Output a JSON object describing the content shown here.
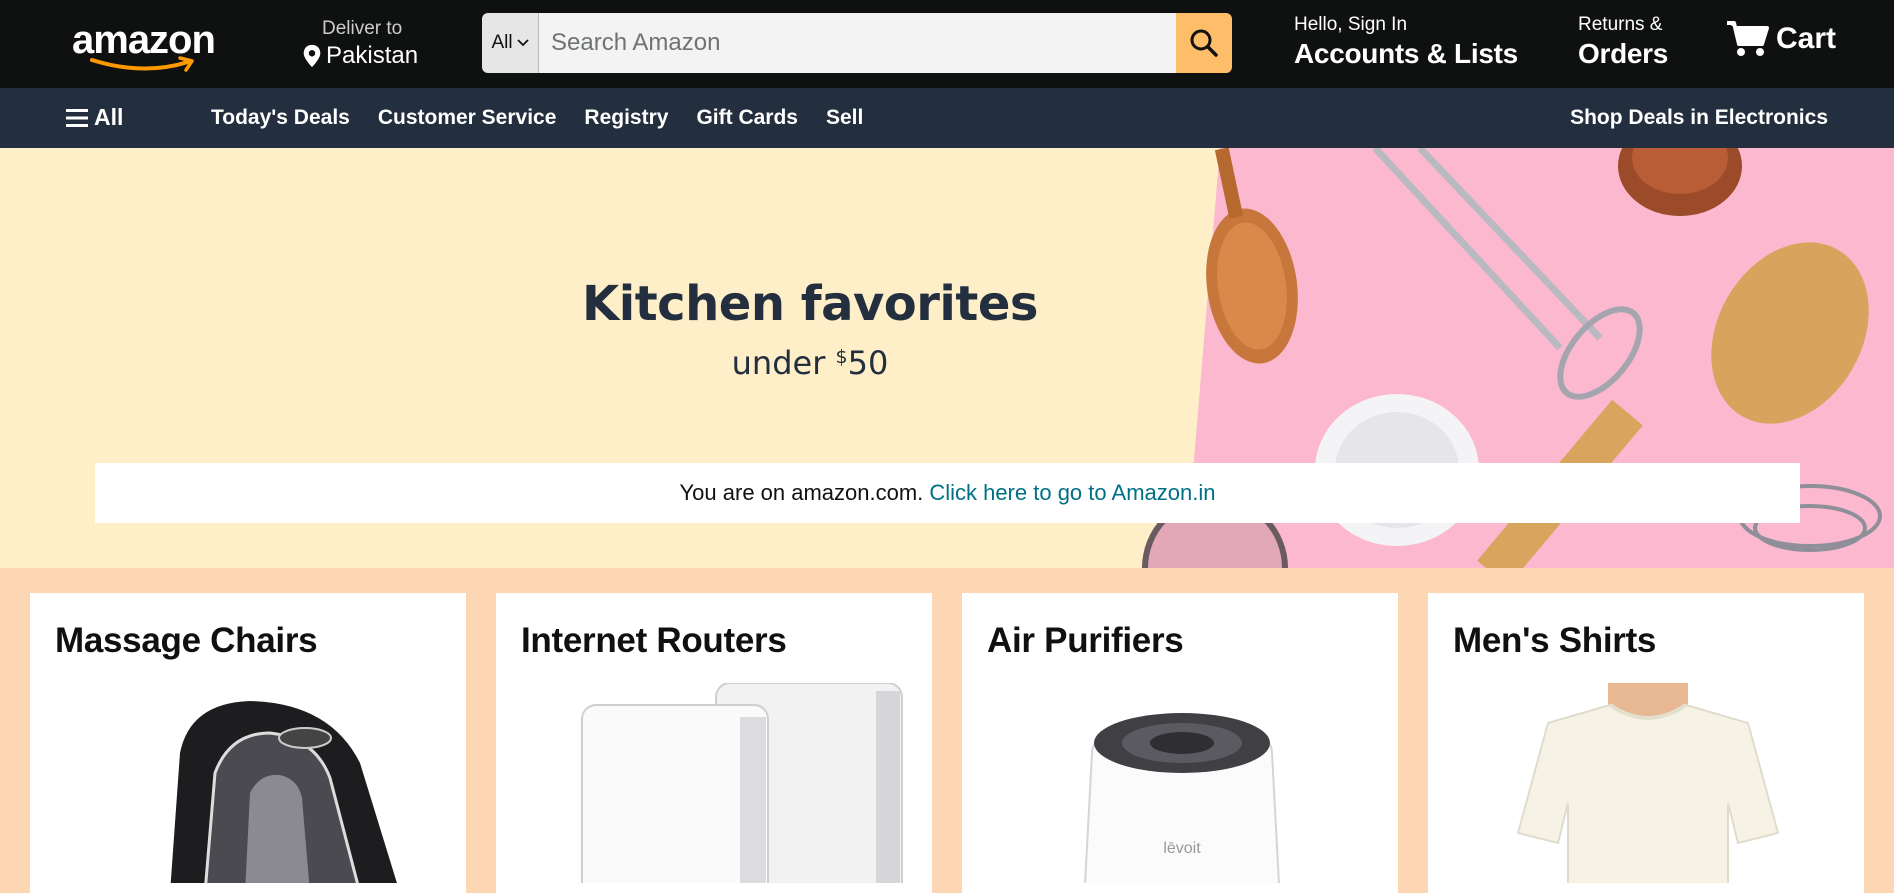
{
  "header": {
    "logo_text": "amazon",
    "deliver_to_label": "Deliver to",
    "deliver_to_location": "Pakistan",
    "search": {
      "category": "All",
      "placeholder": "Search Amazon"
    },
    "account": {
      "greeting": "Hello, Sign In",
      "label": "Accounts & Lists"
    },
    "returns": {
      "line1": "Returns &",
      "line2": "Orders"
    },
    "cart_label": "Cart"
  },
  "nav": {
    "all_label": "All",
    "links": [
      "Today's Deals",
      "Customer Service",
      "Registry",
      "Gift Cards",
      "Sell"
    ],
    "promo": "Shop Deals in Electronics"
  },
  "hero": {
    "title": "Kitchen favorites",
    "subtitle_prefix": "under ",
    "subtitle_currency": "$",
    "subtitle_amount": "50"
  },
  "notice": {
    "text": "You are on amazon.com.",
    "link_text": "Click here to go to Amazon.in"
  },
  "cards": [
    {
      "title": "Massage Chairs"
    },
    {
      "title": "Internet Routers"
    },
    {
      "title": "Air Purifiers"
    },
    {
      "title": "Men's Shirts"
    }
  ],
  "colors": {
    "header_bg": "#0f1111",
    "nav_bg": "#232f3e",
    "search_button": "#febd69",
    "hero_bg": "#feefc8",
    "hero_photo_bg": "#fbb8cf",
    "page_bg": "#fdd7b4",
    "link": "#007185",
    "logo_smile": "#ff9900"
  }
}
